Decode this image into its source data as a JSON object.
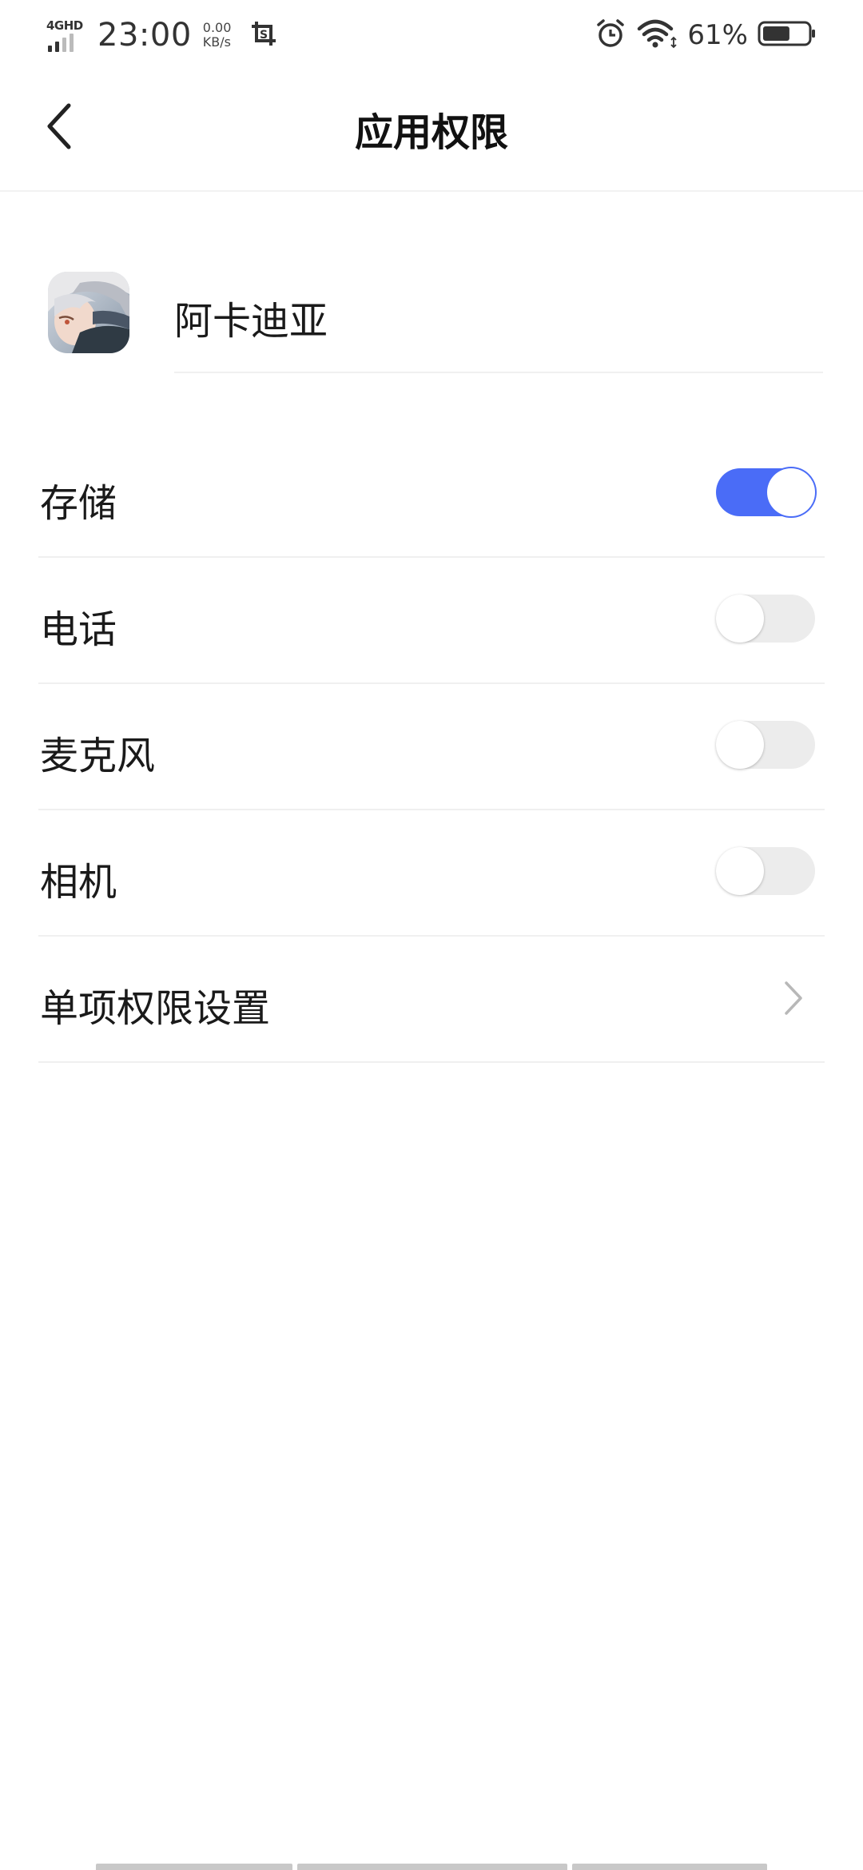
{
  "status_bar": {
    "network": "4GHD",
    "time": "23:00",
    "speed_value": "0.00",
    "speed_unit": "KB/s",
    "battery_percent": "61%",
    "battery_level": 0.61,
    "icons": [
      "signal-icon",
      "screenshot-icon",
      "alarm-icon",
      "wifi-icon",
      "battery-icon"
    ]
  },
  "header": {
    "title": "应用权限",
    "back_icon": "back-arrow-icon"
  },
  "app": {
    "name": "阿卡迪亚",
    "icon": "app-icon"
  },
  "permissions": [
    {
      "label": "存储",
      "enabled": true
    },
    {
      "label": "电话",
      "enabled": false
    },
    {
      "label": "麦克风",
      "enabled": false
    },
    {
      "label": "相机",
      "enabled": false
    }
  ],
  "individual_settings": {
    "label": "单项权限设置",
    "icon": "chevron-right-icon"
  },
  "colors": {
    "accent": "#4a6cf7",
    "toggle_off": "#ececec",
    "divider": "#f0f0f0"
  }
}
